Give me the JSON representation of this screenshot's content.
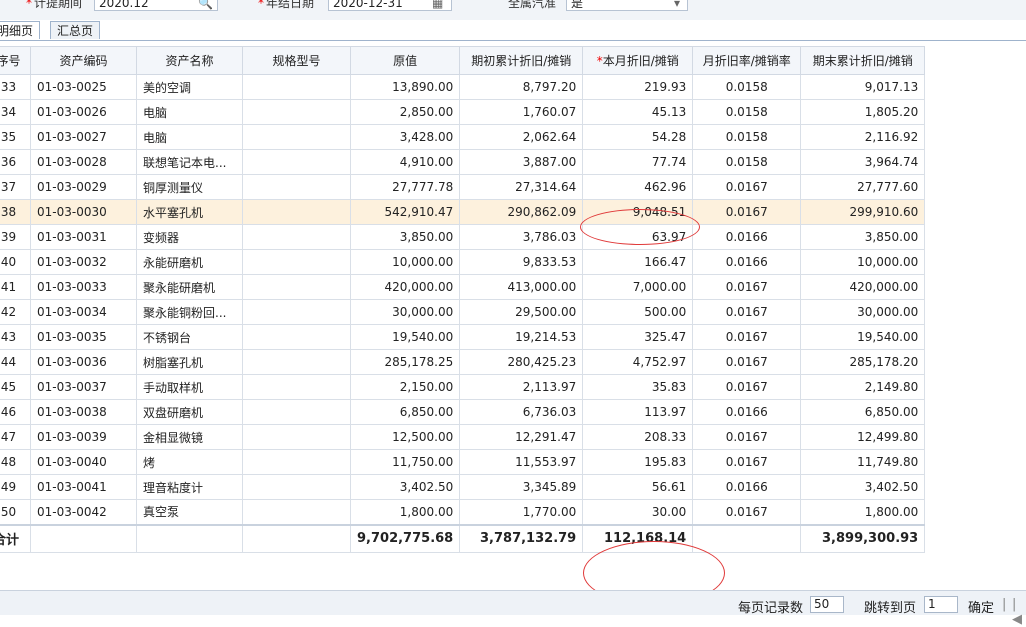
{
  "filters": {
    "period_label": "计提期间",
    "period_value": "2020.12",
    "close_date_label": "年结日期",
    "close_date_value": "2020-12-31",
    "display_label": "全属汽准",
    "display_value": "是"
  },
  "tabs": [
    {
      "label": "明细页"
    },
    {
      "label": "汇总页"
    }
  ],
  "columns": {
    "seq": "序号",
    "code": "资产编码",
    "name": "资产名称",
    "spec": "规格型号",
    "original": "原值",
    "opening": "期初累计折旧/摊销",
    "current": "本月折旧/摊销",
    "current_required_mark": "*",
    "rate": "月折旧率/摊销率",
    "closing": "期末累计折旧/摊销"
  },
  "rows": [
    {
      "seq": "33",
      "code": "01-03-0025",
      "name": "美的空调",
      "spec": "",
      "original": "13,890.00",
      "opening": "8,797.20",
      "current": "219.93",
      "rate": "0.0158",
      "closing": "9,017.13"
    },
    {
      "seq": "34",
      "code": "01-03-0026",
      "name": "电脑",
      "spec": "",
      "original": "2,850.00",
      "opening": "1,760.07",
      "current": "45.13",
      "rate": "0.0158",
      "closing": "1,805.20"
    },
    {
      "seq": "35",
      "code": "01-03-0027",
      "name": "电脑",
      "spec": "",
      "original": "3,428.00",
      "opening": "2,062.64",
      "current": "54.28",
      "rate": "0.0158",
      "closing": "2,116.92"
    },
    {
      "seq": "36",
      "code": "01-03-0028",
      "name": "联想笔记本电...",
      "spec": "",
      "original": "4,910.00",
      "opening": "3,887.00",
      "current": "77.74",
      "rate": "0.0158",
      "closing": "3,964.74"
    },
    {
      "seq": "37",
      "code": "01-03-0029",
      "name": "铜厚测量仪",
      "spec": "",
      "original": "27,777.78",
      "opening": "27,314.64",
      "current": "462.96",
      "rate": "0.0167",
      "closing": "27,777.60"
    },
    {
      "seq": "38",
      "code": "01-03-0030",
      "name": "水平塞孔机",
      "spec": "",
      "original": "542,910.47",
      "opening": "290,862.09",
      "current": "9,048.51",
      "rate": "0.0167",
      "closing": "299,910.60",
      "selected": true
    },
    {
      "seq": "39",
      "code": "01-03-0031",
      "name": "变频器",
      "spec": "",
      "original": "3,850.00",
      "opening": "3,786.03",
      "current": "63.97",
      "rate": "0.0166",
      "closing": "3,850.00"
    },
    {
      "seq": "40",
      "code": "01-03-0032",
      "name": "永能研磨机",
      "spec": "",
      "original": "10,000.00",
      "opening": "9,833.53",
      "current": "166.47",
      "rate": "0.0166",
      "closing": "10,000.00"
    },
    {
      "seq": "41",
      "code": "01-03-0033",
      "name": "聚永能研磨机",
      "spec": "",
      "original": "420,000.00",
      "opening": "413,000.00",
      "current": "7,000.00",
      "rate": "0.0167",
      "closing": "420,000.00"
    },
    {
      "seq": "42",
      "code": "01-03-0034",
      "name": "聚永能铜粉回...",
      "spec": "",
      "original": "30,000.00",
      "opening": "29,500.00",
      "current": "500.00",
      "rate": "0.0167",
      "closing": "30,000.00"
    },
    {
      "seq": "43",
      "code": "01-03-0035",
      "name": "不锈钢台",
      "spec": "",
      "original": "19,540.00",
      "opening": "19,214.53",
      "current": "325.47",
      "rate": "0.0167",
      "closing": "19,540.00"
    },
    {
      "seq": "44",
      "code": "01-03-0036",
      "name": "树脂塞孔机",
      "spec": "",
      "original": "285,178.25",
      "opening": "280,425.23",
      "current": "4,752.97",
      "rate": "0.0167",
      "closing": "285,178.20"
    },
    {
      "seq": "45",
      "code": "01-03-0037",
      "name": "手动取样机",
      "spec": "",
      "original": "2,150.00",
      "opening": "2,113.97",
      "current": "35.83",
      "rate": "0.0167",
      "closing": "2,149.80"
    },
    {
      "seq": "46",
      "code": "01-03-0038",
      "name": "双盘研磨机",
      "spec": "",
      "original": "6,850.00",
      "opening": "6,736.03",
      "current": "113.97",
      "rate": "0.0166",
      "closing": "6,850.00"
    },
    {
      "seq": "47",
      "code": "01-03-0039",
      "name": "金相显微镜",
      "spec": "",
      "original": "12,500.00",
      "opening": "12,291.47",
      "current": "208.33",
      "rate": "0.0167",
      "closing": "12,499.80"
    },
    {
      "seq": "48",
      "code": "01-03-0040",
      "name": "烤",
      "spec": "",
      "original": "11,750.00",
      "opening": "11,553.97",
      "current": "195.83",
      "rate": "0.0167",
      "closing": "11,749.80"
    },
    {
      "seq": "49",
      "code": "01-03-0041",
      "name": "理音粘度计",
      "spec": "",
      "original": "3,402.50",
      "opening": "3,345.89",
      "current": "56.61",
      "rate": "0.0166",
      "closing": "3,402.50"
    },
    {
      "seq": "50",
      "code": "01-03-0042",
      "name": "真空泵",
      "spec": "",
      "original": "1,800.00",
      "opening": "1,770.00",
      "current": "30.00",
      "rate": "0.0167",
      "closing": "1,800.00"
    }
  ],
  "totals": {
    "label": "合计",
    "original": "9,702,775.68",
    "opening": "3,787,132.79",
    "current": "112,168.14",
    "closing": "3,899,300.93"
  },
  "pager": {
    "page_size_label": "每页记录数",
    "page_size_value": "50",
    "goto_label": "跳转到页",
    "goto_value": "1",
    "confirm_label": "确定",
    "separator": "|",
    "first_page_glyph": "|◀"
  },
  "icons": {
    "search": "search-icon",
    "calendar": "calendar-icon",
    "dropdown": "chevron-down-icon"
  },
  "colors": {
    "selected_row": "#fdf1dd",
    "annotation": "#e03a3a",
    "required_mark": "#e00000"
  }
}
